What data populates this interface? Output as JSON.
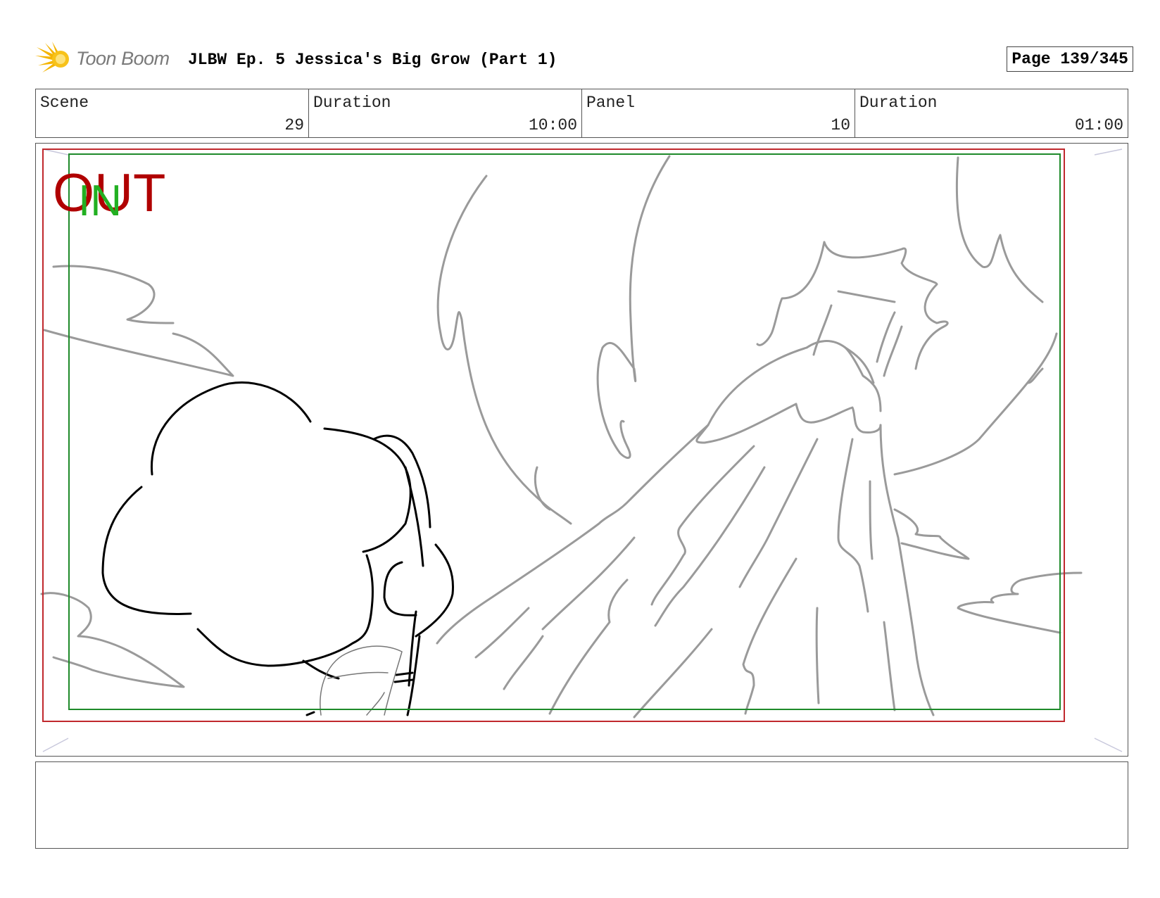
{
  "header": {
    "logo_text": "Toon Boom",
    "logo_icon": "starburst-logo-icon",
    "title": "JLBW Ep. 5 Jessica's Big Grow (Part 1)",
    "page": "Page 139/345"
  },
  "info": {
    "scene_label": "Scene",
    "scene_value": "29",
    "scene_duration_label": "Duration",
    "scene_duration_value": "10:00",
    "panel_label": "Panel",
    "panel_value": "10",
    "panel_duration_label": "Duration",
    "panel_duration_value": "01:00"
  },
  "panel": {
    "out_marker": "OUT",
    "in_marker": "IN",
    "colors": {
      "out_frame": "#c0282d",
      "in_frame": "#1e8a2a",
      "out_text": "#b00000",
      "in_text": "#22b022",
      "sketch_light": "#9a9a9a",
      "sketch_dark": "#000000"
    }
  },
  "notes": {
    "text": ""
  }
}
